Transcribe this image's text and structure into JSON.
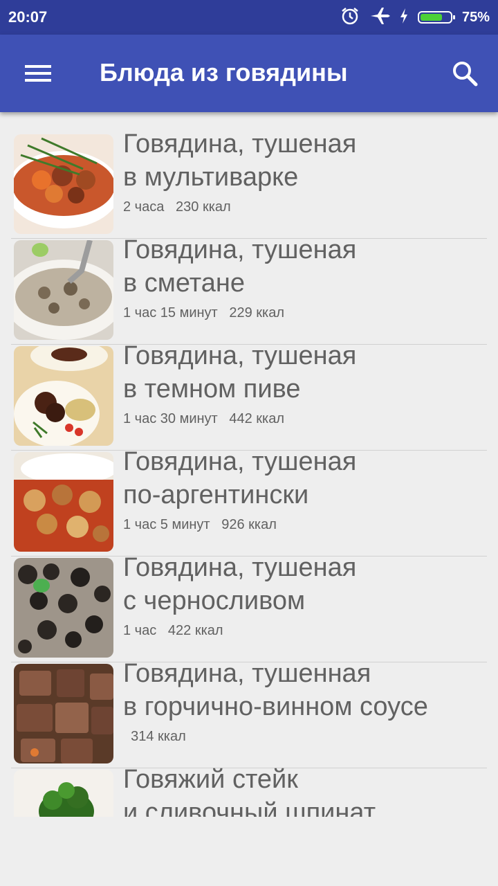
{
  "status": {
    "time": "20:07",
    "battery_pct": "75%",
    "battery_level": 0.75
  },
  "appbar": {
    "title": "Блюда из говядины"
  },
  "recipes": [
    {
      "line1": "Говядина, тушеная",
      "line2": "в мультиварке",
      "time": "2 часа",
      "kcal": "230 ккал"
    },
    {
      "line1": "Говядина, тушеная",
      "line2": "в сметане",
      "time": "1 час 15 минут",
      "kcal": "229 ккал"
    },
    {
      "line1": "Говядина, тушеная",
      "line2": "в темном пиве",
      "time": "1 час 30 минут",
      "kcal": "442 ккал"
    },
    {
      "line1": "Говядина, тушеная",
      "line2": "по-аргентински",
      "time": "1 час 5 минут",
      "kcal": "926 ккал"
    },
    {
      "line1": "Говядина, тушеная",
      "line2": "с черносливом",
      "time": "1 час",
      "kcal": "422 ккал"
    },
    {
      "line1": "Говядина, тушенная",
      "line2": "в горчично-винном соусе",
      "time": "",
      "kcal": "314 ккал"
    },
    {
      "line1": "Говяжий стейк",
      "line2": "и сливочный шпинат",
      "time": "",
      "kcal": ""
    }
  ]
}
